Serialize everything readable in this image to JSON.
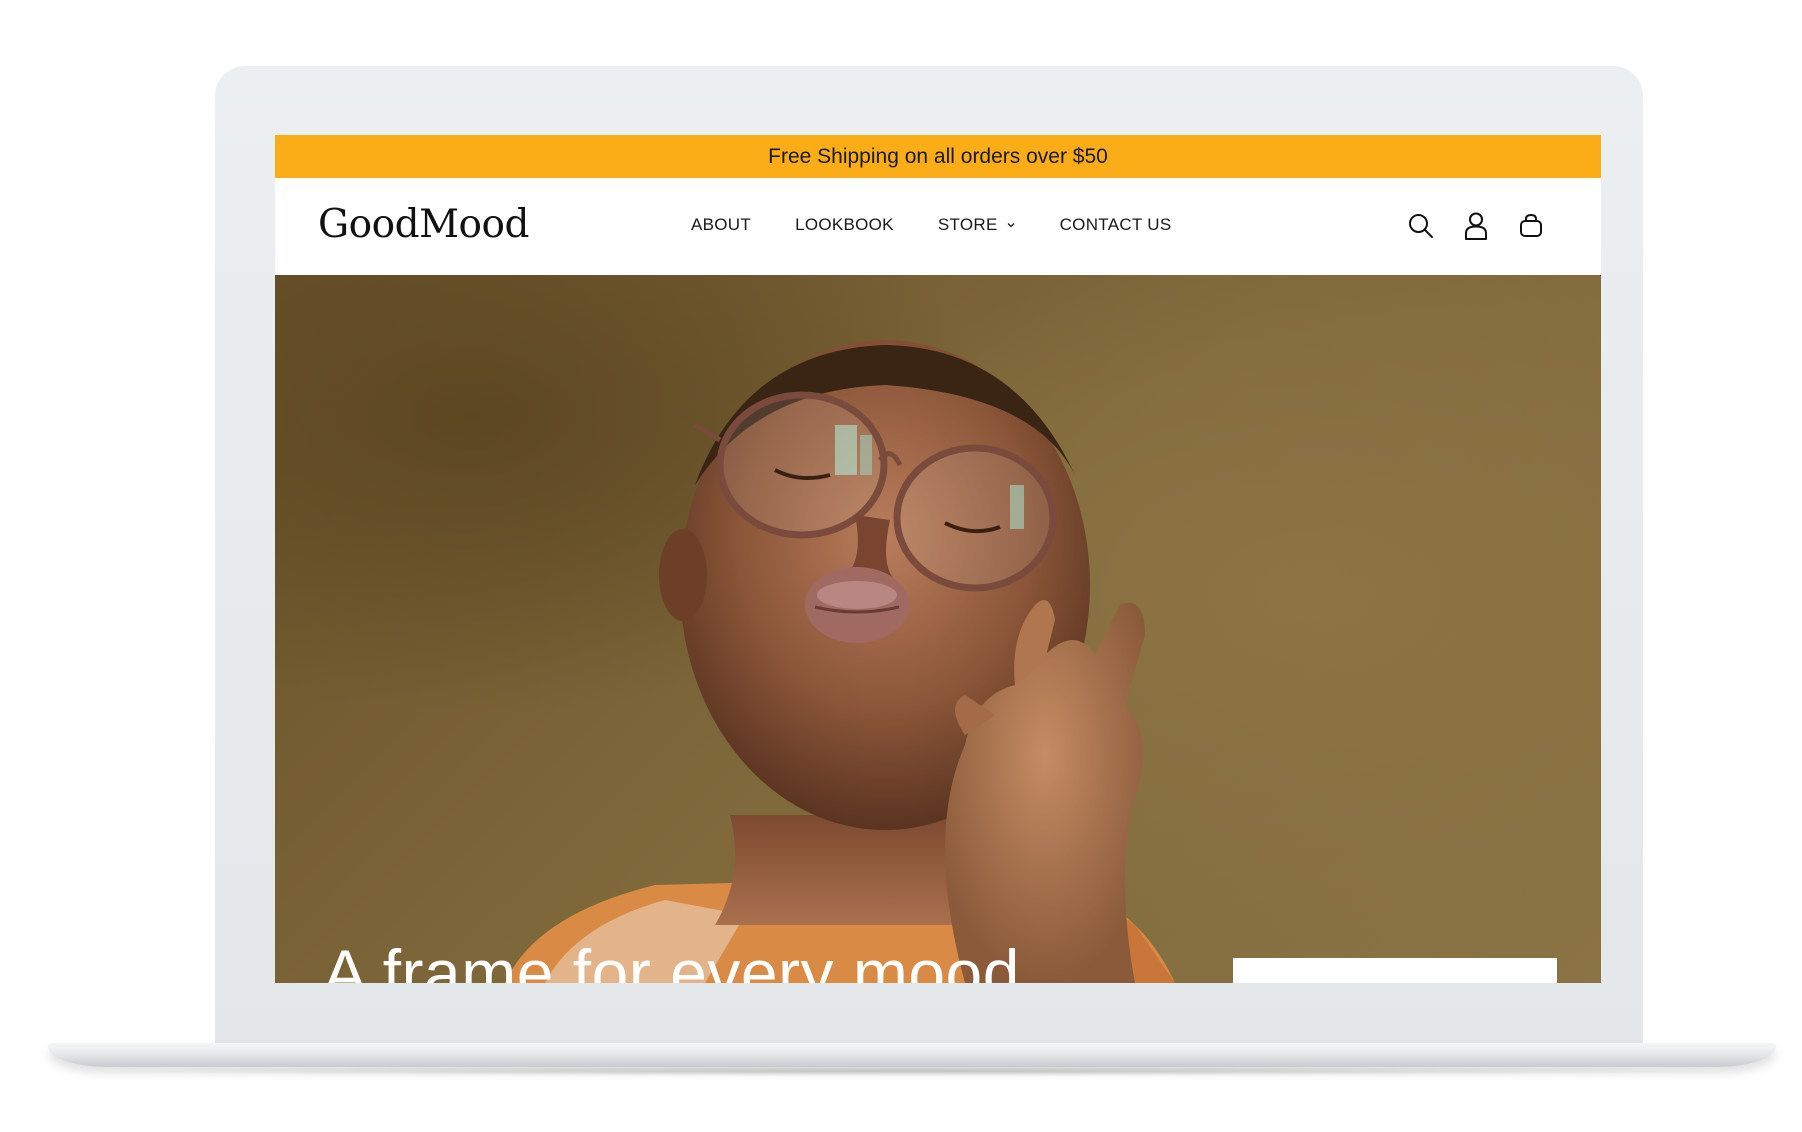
{
  "announcement": {
    "text": "Free Shipping on all orders over $50"
  },
  "header": {
    "logo": "GoodMood",
    "nav": [
      {
        "label": "ABOUT"
      },
      {
        "label": "LOOKBOOK"
      },
      {
        "label": "STORE",
        "has_dropdown": true
      },
      {
        "label": "CONTACT US"
      }
    ],
    "icons": [
      "search-icon",
      "account-icon",
      "cart-icon"
    ]
  },
  "hero": {
    "title": "A frame for every mood"
  },
  "colors": {
    "announcement_bg": "#fbad17",
    "header_bg": "#ffffff",
    "hero_bg": "#7a633a",
    "text_dark": "#1a1a1a"
  }
}
